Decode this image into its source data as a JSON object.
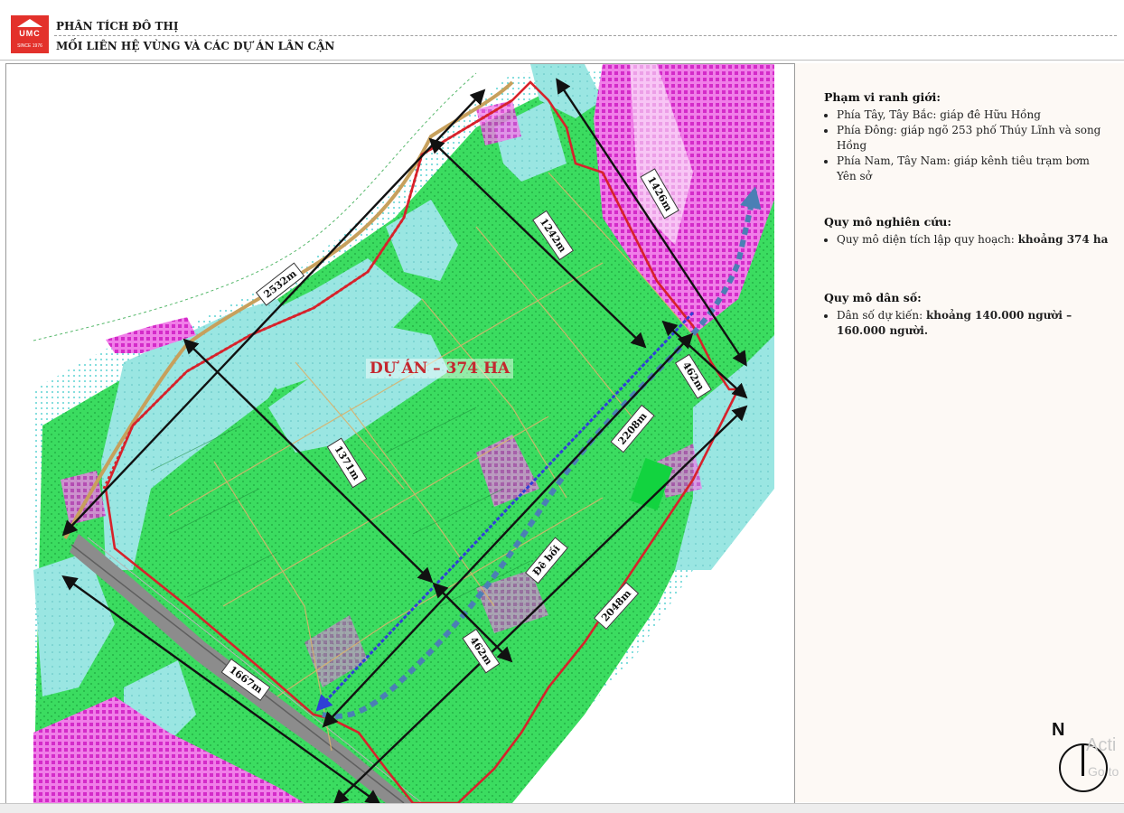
{
  "header": {
    "logo_mark": "UMC",
    "logo_since": "SINCE 1976",
    "title": "PHÂN TÍCH ĐÔ THỊ",
    "subtitle": "MỐI LIÊN HỆ VÙNG VÀ CÁC DỰ ÁN LÂN CẬN"
  },
  "map": {
    "project_label": "DỰ ÁN – 374 HA",
    "dimensions": [
      "2532m",
      "1242m",
      "1426m",
      "462m",
      "2208m",
      "1371m",
      "Đê bối",
      "462m",
      "2048m",
      "1667m"
    ],
    "colors": {
      "water": "#8ee0df",
      "green": "#35d95a",
      "magenta": "#e04ad8",
      "boundary": "#d7222b",
      "blue_line": "#2f3fd6",
      "dike": "#4b7fb5"
    },
    "north_label": "N"
  },
  "info": {
    "sections": [
      {
        "heading": "Phạm vi ranh giới:",
        "items": [
          "Phía Tây, Tây Bắc: giáp đê Hữu Hồng",
          "Phía Đông: giáp ngõ 253 phố Thúy Lĩnh và song Hồng",
          "Phía Nam, Tây Nam: giáp kênh tiêu trạm bơm Yên sở"
        ]
      },
      {
        "heading": "Quy mô nghiên cứu:",
        "item_prefix": "Quy mô diện tích lập quy hoạch: ",
        "item_bold": "khoảng 374 ha"
      },
      {
        "heading": "Quy mô dân số:",
        "item_prefix": "Dân số dự kiến: ",
        "item_bold": "khoảng 140.000 người – 160.000 người."
      }
    ]
  },
  "watermark": {
    "line1": "Acti",
    "line2": "Go to"
  }
}
